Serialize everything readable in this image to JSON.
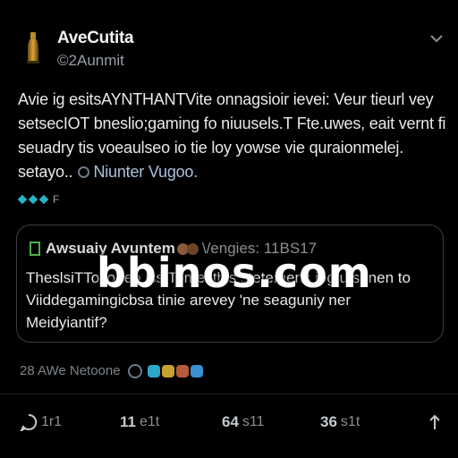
{
  "author": {
    "name": "AveCutita",
    "handle": "©2Aunmit"
  },
  "post": {
    "lines": [
      "Avie ig esitsAYNTHANTVite onnagsioir ievei: Veur tieurl vey",
      "setsecIOT bneslio;gaming fo niuusels.T Fte.uwes, eait vernt fi",
      "seuadry tis voeaulseo io tie loy yowse vie quraionmelej.",
      "setayo.."
    ],
    "mention": "Niunter Vugoo.",
    "emoji_tail": "F"
  },
  "quote": {
    "name": "Awsuaiy Avuntem",
    "handle": "\\/engies: 11BS17",
    "lines": [
      "TheslsiTTo;ioneo iss.Tomesthis stetemens jog.u sunen to",
      "Viiddegamingicbsa tinie arevey 'ne seaguniy ner",
      "Meidyiantif?"
    ]
  },
  "watermark": "bbinos.com",
  "meta": {
    "timestamp": "28 AWe Netoone"
  },
  "actions": {
    "reply_count": "1r1",
    "retweet_count": "11",
    "retweet_suffix": "e1t",
    "like_count": "64",
    "like_suffix": "s11",
    "views_count": "36",
    "views_suffix": "s1t"
  },
  "icons": {
    "avatar": "bottle-avatar-icon",
    "more": "chevron-down-icon",
    "reply": "reply-icon",
    "share": "share-icon"
  },
  "colors": {
    "background": "#000000",
    "text": "#e7e9ea",
    "muted": "#8b9096",
    "accent": "#27b3c8",
    "border": "#3a3d42"
  }
}
